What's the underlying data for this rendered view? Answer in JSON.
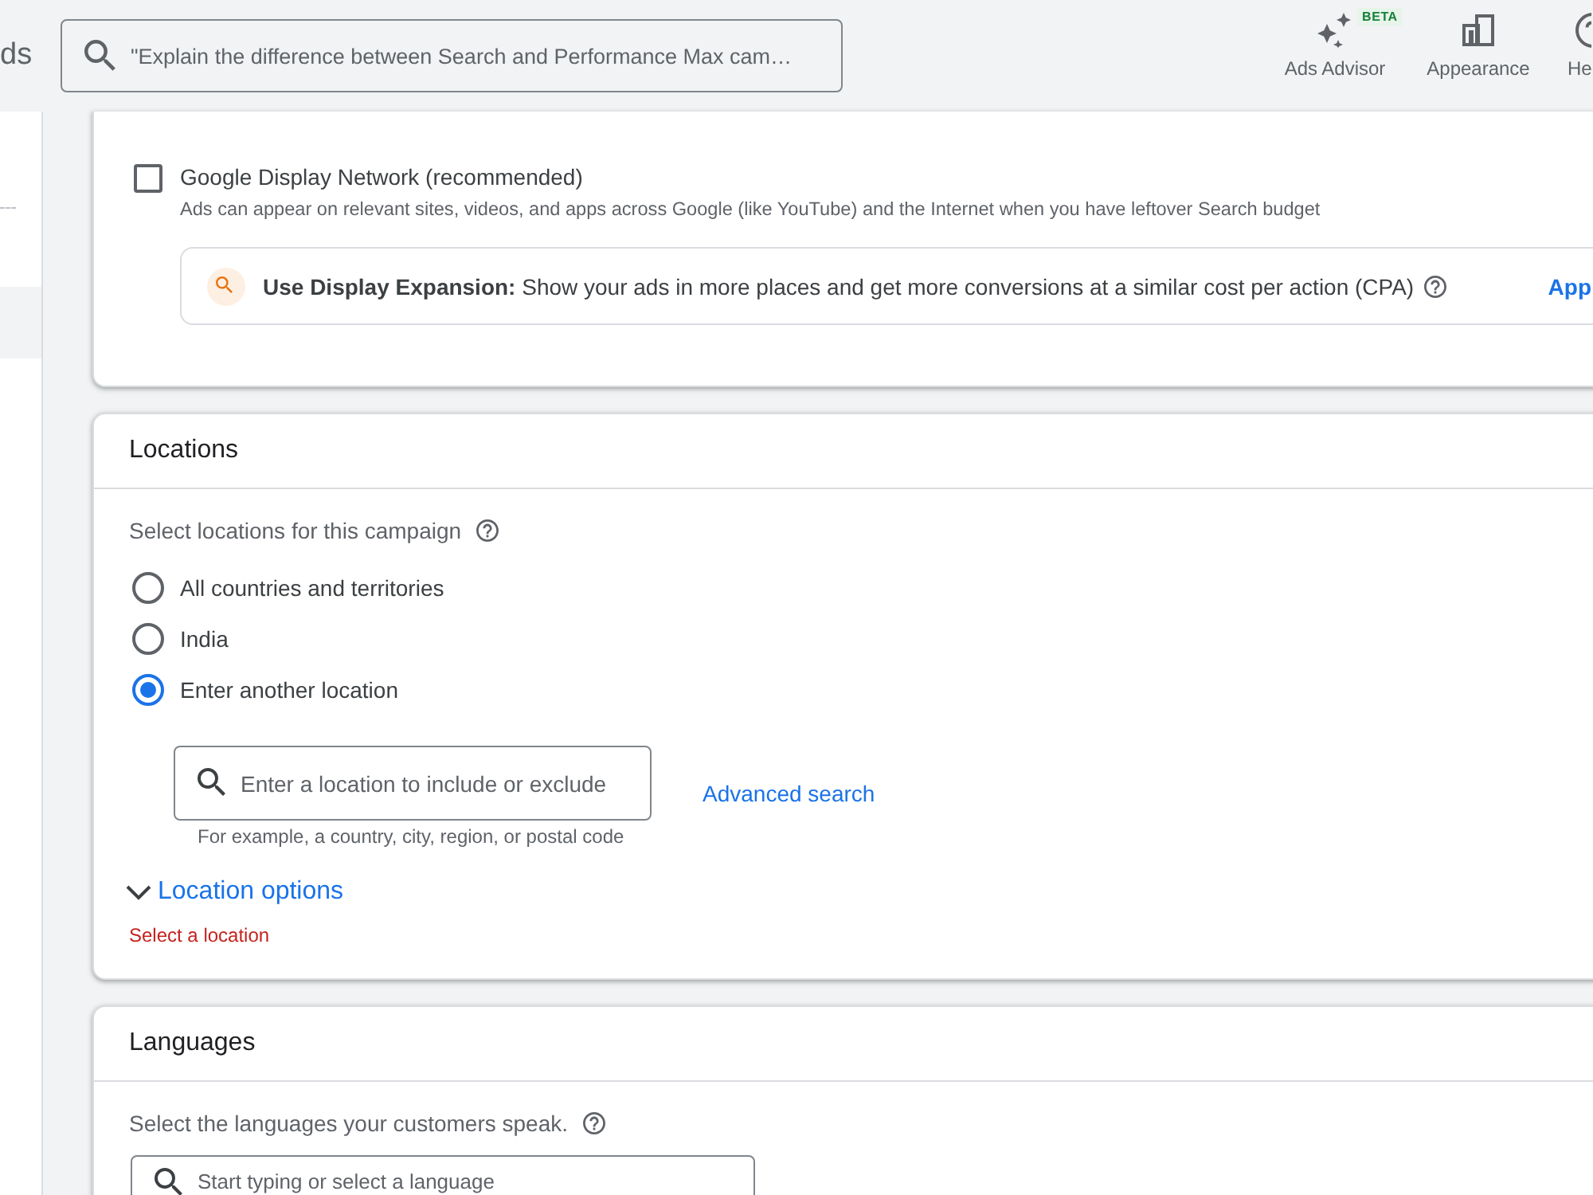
{
  "header": {
    "logo": "ds",
    "search": {
      "placeholder": "\"Explain the difference between Search and Performance Max cam…"
    },
    "actions": [
      {
        "kind": "advisor",
        "label": "Ads Advisor",
        "badge": "BETA"
      },
      {
        "kind": "appearance",
        "label": "Appearance"
      },
      {
        "kind": "help",
        "label": "He"
      }
    ]
  },
  "networks": {
    "options": [
      {
        "label": "Google Display Network (recommended)",
        "description": "Ads can appear on relevant sites, videos, and apps across Google (like YouTube) and the Internet when you have leftover Search budget",
        "checked": false
      }
    ],
    "suggestion": {
      "text": "**Use Display Expansion:** Show your ads in more places and get more conversions at a similar cost per action (CPA)",
      "action": "App"
    }
  },
  "locations": {
    "title": "Locations",
    "prompt": "Select locations for this campaign",
    "options": [
      {
        "label": "All countries and territories",
        "selected": false
      },
      {
        "label": "India",
        "selected": false
      },
      {
        "label": "Enter another location",
        "selected": true
      }
    ],
    "search": {
      "placeholder": "Enter a location to include or exclude",
      "hint": "For example, a country, city, region, or postal code"
    },
    "advanced_link": "Advanced search",
    "options_toggle": {
      "label": "Location options",
      "expanded": false
    },
    "error": "Select a location"
  },
  "languages": {
    "title": "Languages",
    "prompt": "Select the languages your customers speak.",
    "search": {
      "placeholder": "Start typing or select a language"
    }
  }
}
